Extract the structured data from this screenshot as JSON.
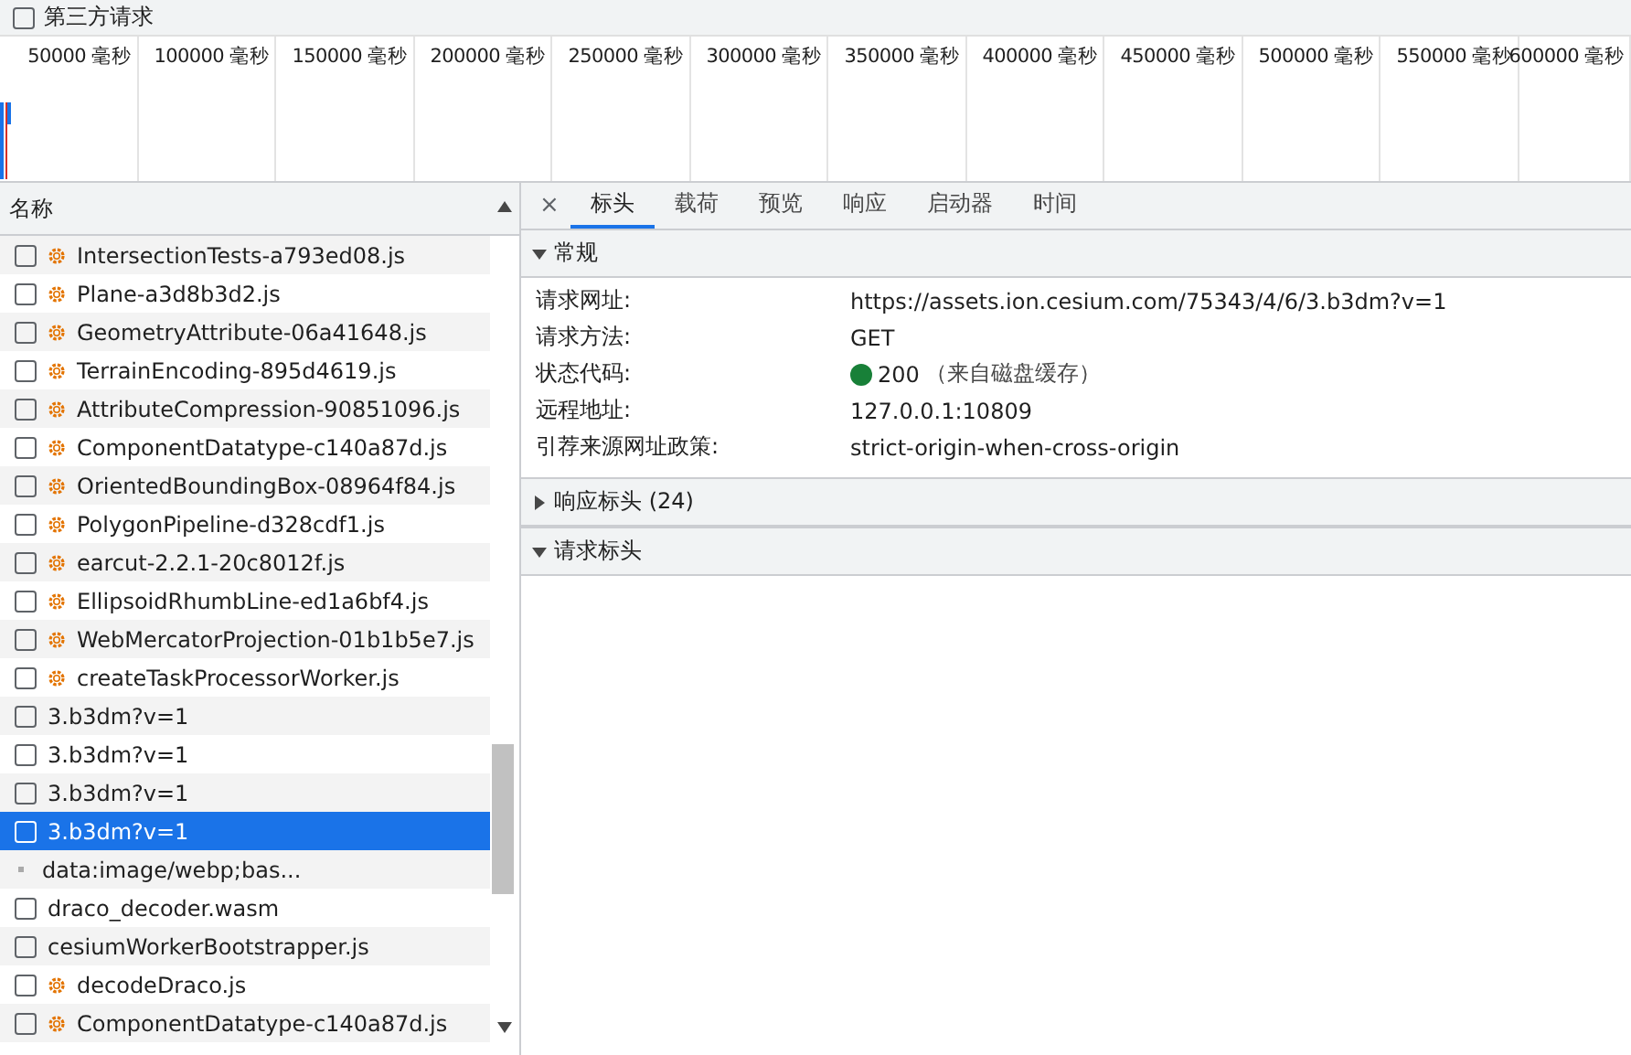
{
  "filter": {
    "label": "第三方请求",
    "checked": false
  },
  "timeline": {
    "ticks": [
      "50000 毫秒",
      "100000 毫秒",
      "150000 毫秒",
      "200000 毫秒",
      "250000 毫秒",
      "300000 毫秒",
      "350000 毫秒",
      "400000 毫秒",
      "450000 毫秒",
      "500000 毫秒",
      "550000 毫秒",
      "600000 毫秒"
    ]
  },
  "list": {
    "header": "名称",
    "rows": [
      {
        "name": "IntersectionTests-a793ed08.js",
        "kind": "script",
        "selected": false
      },
      {
        "name": "Plane-a3d8b3d2.js",
        "kind": "script",
        "selected": false
      },
      {
        "name": "GeometryAttribute-06a41648.js",
        "kind": "script",
        "selected": false
      },
      {
        "name": "TerrainEncoding-895d4619.js",
        "kind": "script",
        "selected": false
      },
      {
        "name": "AttributeCompression-90851096.js",
        "kind": "script",
        "selected": false
      },
      {
        "name": "ComponentDatatype-c140a87d.js",
        "kind": "script",
        "selected": false
      },
      {
        "name": "OrientedBoundingBox-08964f84.js",
        "kind": "script",
        "selected": false
      },
      {
        "name": "PolygonPipeline-d328cdf1.js",
        "kind": "script",
        "selected": false
      },
      {
        "name": "earcut-2.2.1-20c8012f.js",
        "kind": "script",
        "selected": false
      },
      {
        "name": "EllipsoidRhumbLine-ed1a6bf4.js",
        "kind": "script",
        "selected": false
      },
      {
        "name": "WebMercatorProjection-01b1b5e7.js",
        "kind": "script",
        "selected": false
      },
      {
        "name": "createTaskProcessorWorker.js",
        "kind": "script",
        "selected": false
      },
      {
        "name": "3.b3dm?v=1",
        "kind": "file",
        "selected": false
      },
      {
        "name": "3.b3dm?v=1",
        "kind": "file",
        "selected": false
      },
      {
        "name": "3.b3dm?v=1",
        "kind": "file",
        "selected": false
      },
      {
        "name": "3.b3dm?v=1",
        "kind": "file",
        "selected": true
      },
      {
        "name": "data:image/webp;bas...",
        "kind": "image",
        "selected": false
      },
      {
        "name": "draco_decoder.wasm",
        "kind": "file",
        "selected": false
      },
      {
        "name": "cesiumWorkerBootstrapper.js",
        "kind": "file",
        "selected": false
      },
      {
        "name": "decodeDraco.js",
        "kind": "script",
        "selected": false
      },
      {
        "name": "ComponentDatatype-c140a87d.js",
        "kind": "script",
        "selected": false
      }
    ]
  },
  "details": {
    "close": "×",
    "tabs": [
      {
        "label": "标头",
        "selected": true
      },
      {
        "label": "载荷",
        "selected": false
      },
      {
        "label": "预览",
        "selected": false
      },
      {
        "label": "响应",
        "selected": false
      },
      {
        "label": "启动器",
        "selected": false
      },
      {
        "label": "时间",
        "selected": false
      }
    ],
    "sections": [
      {
        "title": "常规",
        "expanded": true,
        "fields": [
          {
            "label": "请求网址:",
            "value": "https://assets.ion.cesium.com/75343/4/6/3.b3dm?v=1",
            "kind": "text"
          },
          {
            "label": "请求方法:",
            "value": "GET",
            "kind": "text"
          },
          {
            "label": "状态代码:",
            "value": "200",
            "note": "（来自磁盘缓存）",
            "kind": "status"
          },
          {
            "label": "远程地址:",
            "value": "127.0.0.1:10809",
            "kind": "text"
          },
          {
            "label": "引荐来源网址政策:",
            "value": "strict-origin-when-cross-origin",
            "kind": "text"
          }
        ]
      },
      {
        "title": "响应标头 (24)",
        "expanded": false
      },
      {
        "title": "请求标头",
        "expanded": true
      }
    ]
  }
}
